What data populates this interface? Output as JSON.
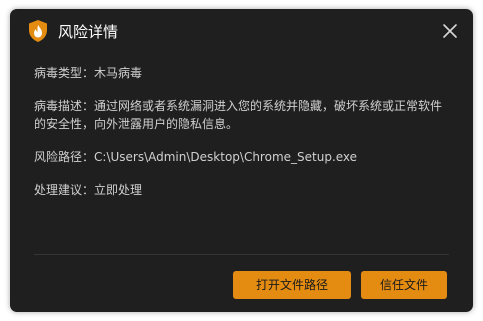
{
  "window": {
    "title": "风险详情",
    "icon": "shield-flame-icon",
    "close_icon": "close-icon"
  },
  "details": {
    "type_label": "病毒类型：",
    "type_value": "木马病毒",
    "desc_label": "病毒描述：",
    "desc_value": "通过网络或者系统漏洞进入您的系统并隐藏，破坏系统或正常软件的安全性，向外泄露用户的隐私信息。",
    "path_label": "风险路径：",
    "path_value": "C:\\Users\\Admin\\Desktop\\Chrome_Setup.exe",
    "advice_label": "处理建议：",
    "advice_value": "立即处理"
  },
  "actions": {
    "open_path_label": "打开文件路径",
    "trust_label": "信任文件"
  },
  "colors": {
    "background": "#1f1f1f",
    "accent": "#e48b12",
    "text": "#d0d0d0",
    "title": "#ffffff"
  }
}
